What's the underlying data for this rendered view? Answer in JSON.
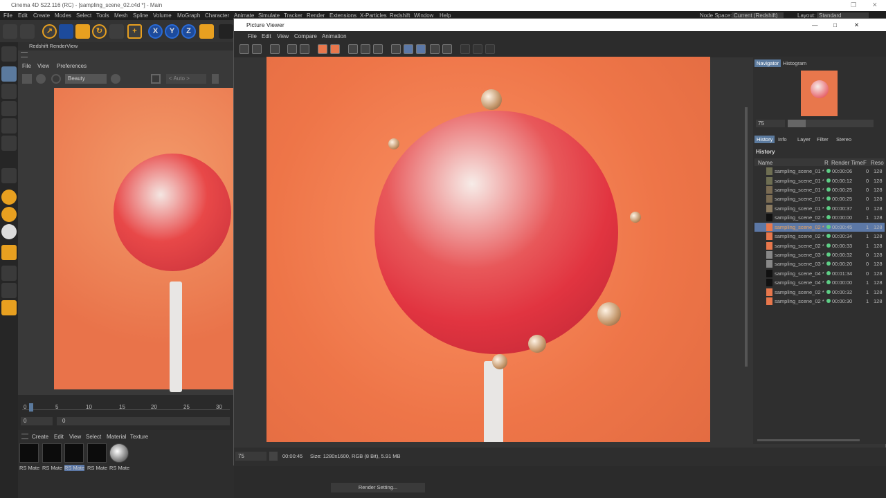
{
  "window": {
    "title": "Cinema 4D S22.116 (RC) - [sampling_scene_02.c4d *] - Main"
  },
  "menu": [
    "File",
    "Edit",
    "Create",
    "Modes",
    "Select",
    "Tools",
    "Mesh",
    "Spline",
    "Volume",
    "MoGraph",
    "Character",
    "Animate",
    "Simulate",
    "Tracker",
    "Render",
    "Extensions",
    "X-Particles",
    "Redshift",
    "Window",
    "Help"
  ],
  "node_space": {
    "label": "Node Space:",
    "value": "Current (Redshift)"
  },
  "layout": {
    "label": "Layout:",
    "value": "Standard"
  },
  "axis": [
    "X",
    "Y",
    "Z"
  ],
  "rsview": {
    "title": "Redshift RenderView",
    "menu": [
      "File",
      "View",
      "Preferences"
    ],
    "aov": "Beauty",
    "auto": "< Auto >"
  },
  "timeline": {
    "ticks": [
      "0",
      "5",
      "10",
      "15",
      "20",
      "25",
      "30"
    ],
    "frame": "0",
    "current": "0"
  },
  "materials": {
    "menu": [
      "Create",
      "Edit",
      "View",
      "Select",
      "Material",
      "Texture"
    ],
    "labels": [
      "RS Mate",
      "RS Mate",
      "RS Mate",
      "RS Mate",
      "RS Mate"
    ]
  },
  "render_settings": "Render Setting...",
  "pv": {
    "title": "Picture Viewer",
    "menu": [
      "File",
      "Edit",
      "View",
      "Compare",
      "Animation"
    ],
    "zoom": "75",
    "time": "00:00:45",
    "size": "Size: 1280x1600, RGB (8 Bit), 5.91 MB",
    "nav_tabs": [
      "Navigator",
      "Histogram"
    ],
    "nav_zoom": "75",
    "tabs": [
      "History",
      "Info",
      "Layer",
      "Filter",
      "Stereo"
    ],
    "history_label": "History",
    "cols": {
      "name": "Name",
      "r": "R",
      "time": "Render Time",
      "f": "F",
      "res": "Reso"
    },
    "history": [
      {
        "name": "sampling_scene_01 *",
        "time": "00:00:06",
        "f": "0",
        "res": "128"
      },
      {
        "name": "sampling_scene_01 *",
        "time": "00:00:12",
        "f": "0",
        "res": "128"
      },
      {
        "name": "sampling_scene_01 *",
        "time": "00:00:25",
        "f": "0",
        "res": "128"
      },
      {
        "name": "sampling_scene_01 *",
        "time": "00:00:25",
        "f": "0",
        "res": "128"
      },
      {
        "name": "sampling_scene_01 *",
        "time": "00:00:37",
        "f": "0",
        "res": "128"
      },
      {
        "name": "sampling_scene_02 *",
        "time": "00:00:00",
        "f": "1",
        "res": "128"
      },
      {
        "name": "sampling_scene_02 *",
        "time": "00:00:45",
        "f": "1",
        "res": "128"
      },
      {
        "name": "sampling_scene_02 *",
        "time": "00:00:34",
        "f": "1",
        "res": "128"
      },
      {
        "name": "sampling_scene_02 *",
        "time": "00:00:33",
        "f": "1",
        "res": "128"
      },
      {
        "name": "sampling_scene_03 *",
        "time": "00:00:32",
        "f": "0",
        "res": "128"
      },
      {
        "name": "sampling_scene_03 *",
        "time": "00:00:20",
        "f": "0",
        "res": "128"
      },
      {
        "name": "sampling_scene_04 *",
        "time": "00:01:34",
        "f": "0",
        "res": "128"
      },
      {
        "name": "sampling_scene_04 *",
        "time": "00:00:00",
        "f": "1",
        "res": "128"
      },
      {
        "name": "sampling_scene_02 *",
        "time": "00:00:32",
        "f": "1",
        "res": "128"
      },
      {
        "name": "sampling_scene_02 *",
        "time": "00:00:30",
        "f": "1",
        "res": "128"
      }
    ]
  }
}
